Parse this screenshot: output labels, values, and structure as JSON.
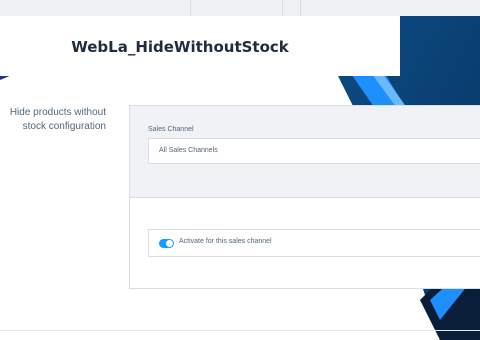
{
  "page": {
    "title": "WebLa_HideWithoutStock"
  },
  "sidebar": {
    "label_line1": "Hide products without",
    "label_line2": "stock configuration"
  },
  "form": {
    "sales_channel_label": "Sales Channel",
    "sales_channel_value": "All Sales Channels",
    "activate_label": "Activate for this sales channel",
    "activate_on": true
  },
  "colors": {
    "accent": "#189eff",
    "brand_dark": "#0a2a6b",
    "brand_purple": "#3b2a8f"
  }
}
